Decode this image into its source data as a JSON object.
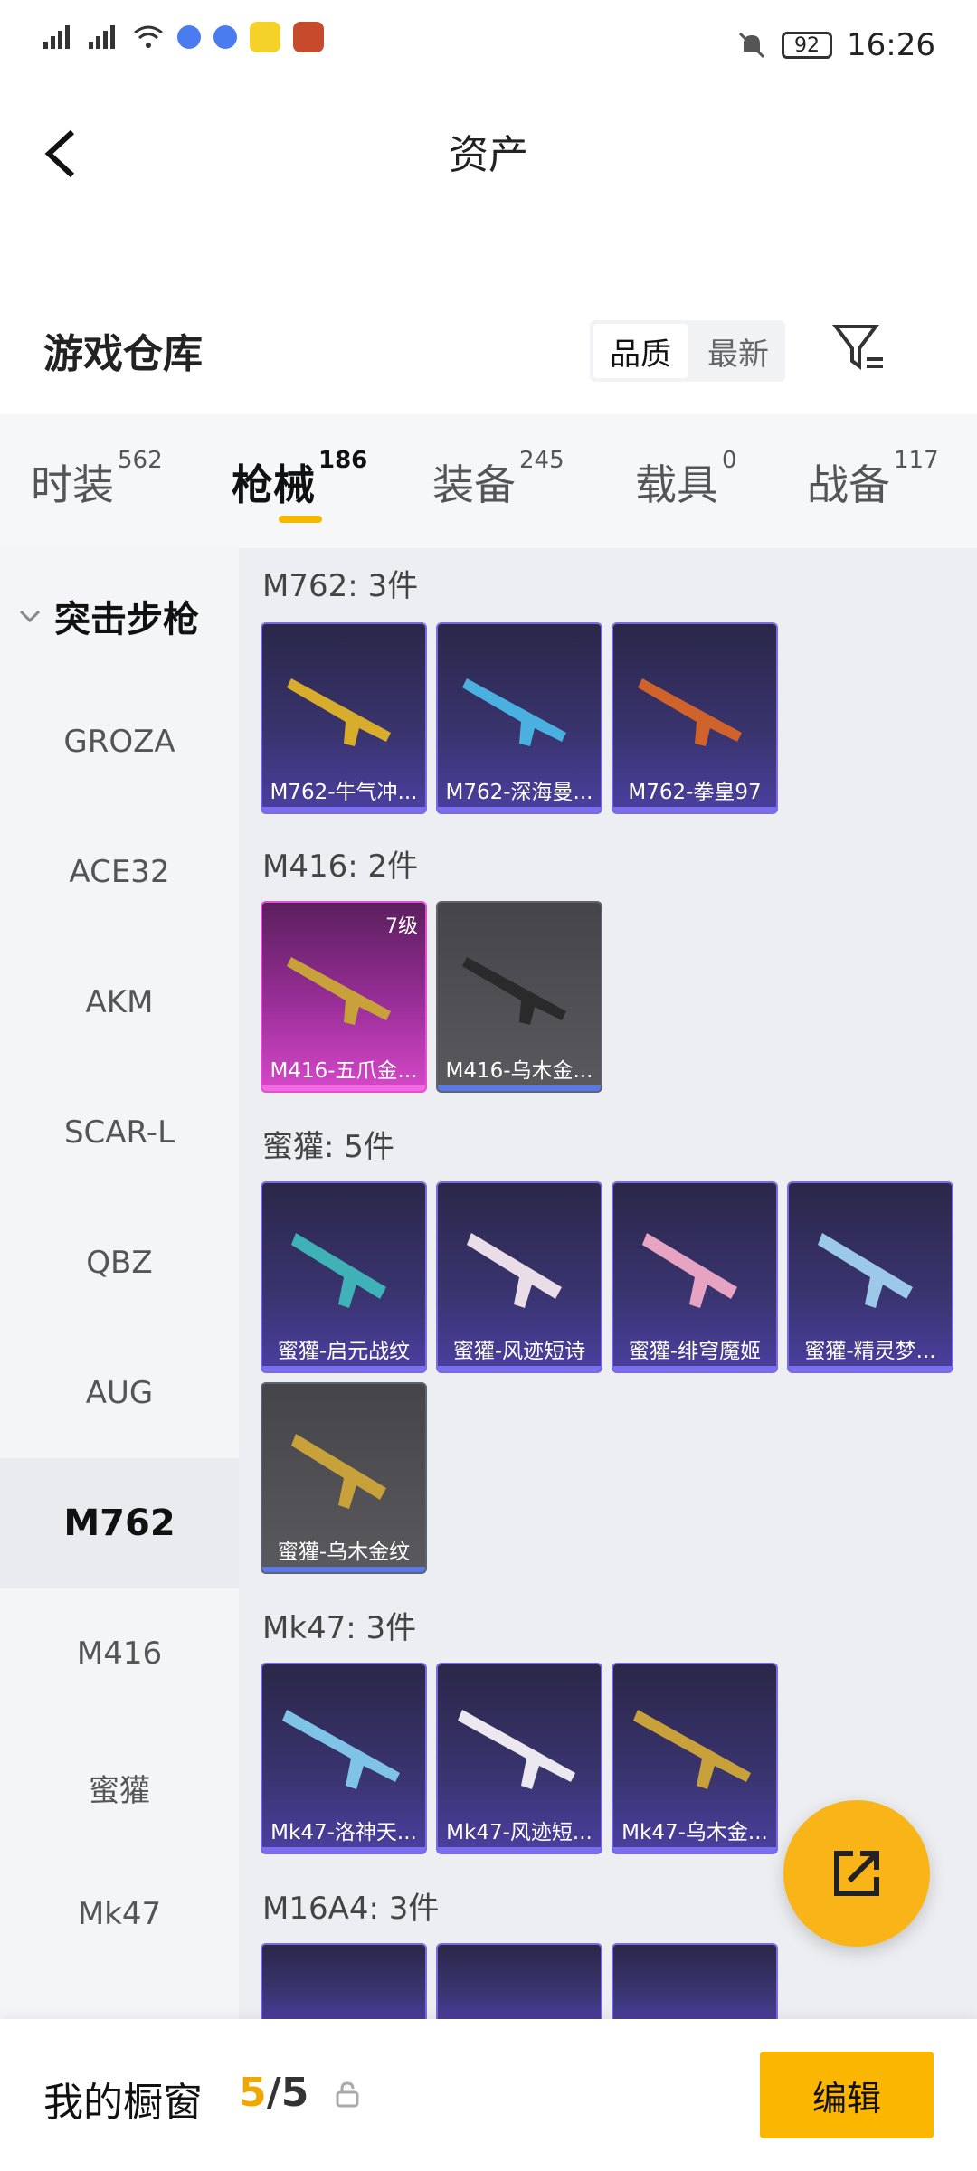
{
  "status": {
    "time": "16:26",
    "battery": "92"
  },
  "header": {
    "title": "资产"
  },
  "warehouse": {
    "title": "游戏仓库",
    "sort": [
      "品质",
      "最新"
    ]
  },
  "tabs": [
    {
      "label": "时装",
      "count": "562"
    },
    {
      "label": "枪械",
      "count": "186"
    },
    {
      "label": "装备",
      "count": "245"
    },
    {
      "label": "载具",
      "count": "0"
    },
    {
      "label": "战备",
      "count": "117"
    }
  ],
  "sidebar": {
    "group": "突击步枪",
    "items": [
      "GROZA",
      "ACE32",
      "AKM",
      "SCAR-L",
      "QBZ",
      "AUG",
      "M762",
      "M416",
      "蜜獾",
      "Mk47"
    ]
  },
  "groups": [
    {
      "head": "M762: 3件",
      "items": [
        "M762-牛气冲...",
        "M762-深海曼...",
        "M762-拳皇97"
      ]
    },
    {
      "head": "M416: 2件",
      "items": [
        "M416-五爪金...",
        "M416-乌木金..."
      ],
      "level": "7级"
    },
    {
      "head": "蜜獾: 5件",
      "items": [
        "蜜獾-启元战纹",
        "蜜獾-风迹短诗",
        "蜜獾-绯穹魔姬",
        "蜜獾-精灵梦...",
        "蜜獾-乌木金纹"
      ]
    },
    {
      "head": "Mk47: 3件",
      "items": [
        "Mk47-洛神天...",
        "Mk47-风迹短...",
        "Mk47-乌木金..."
      ]
    },
    {
      "head": "M16A4: 3件",
      "items": []
    }
  ],
  "bottom": {
    "title": "我的橱窗",
    "current": "5",
    "sep": "/",
    "total": "5",
    "edit": "编辑"
  }
}
